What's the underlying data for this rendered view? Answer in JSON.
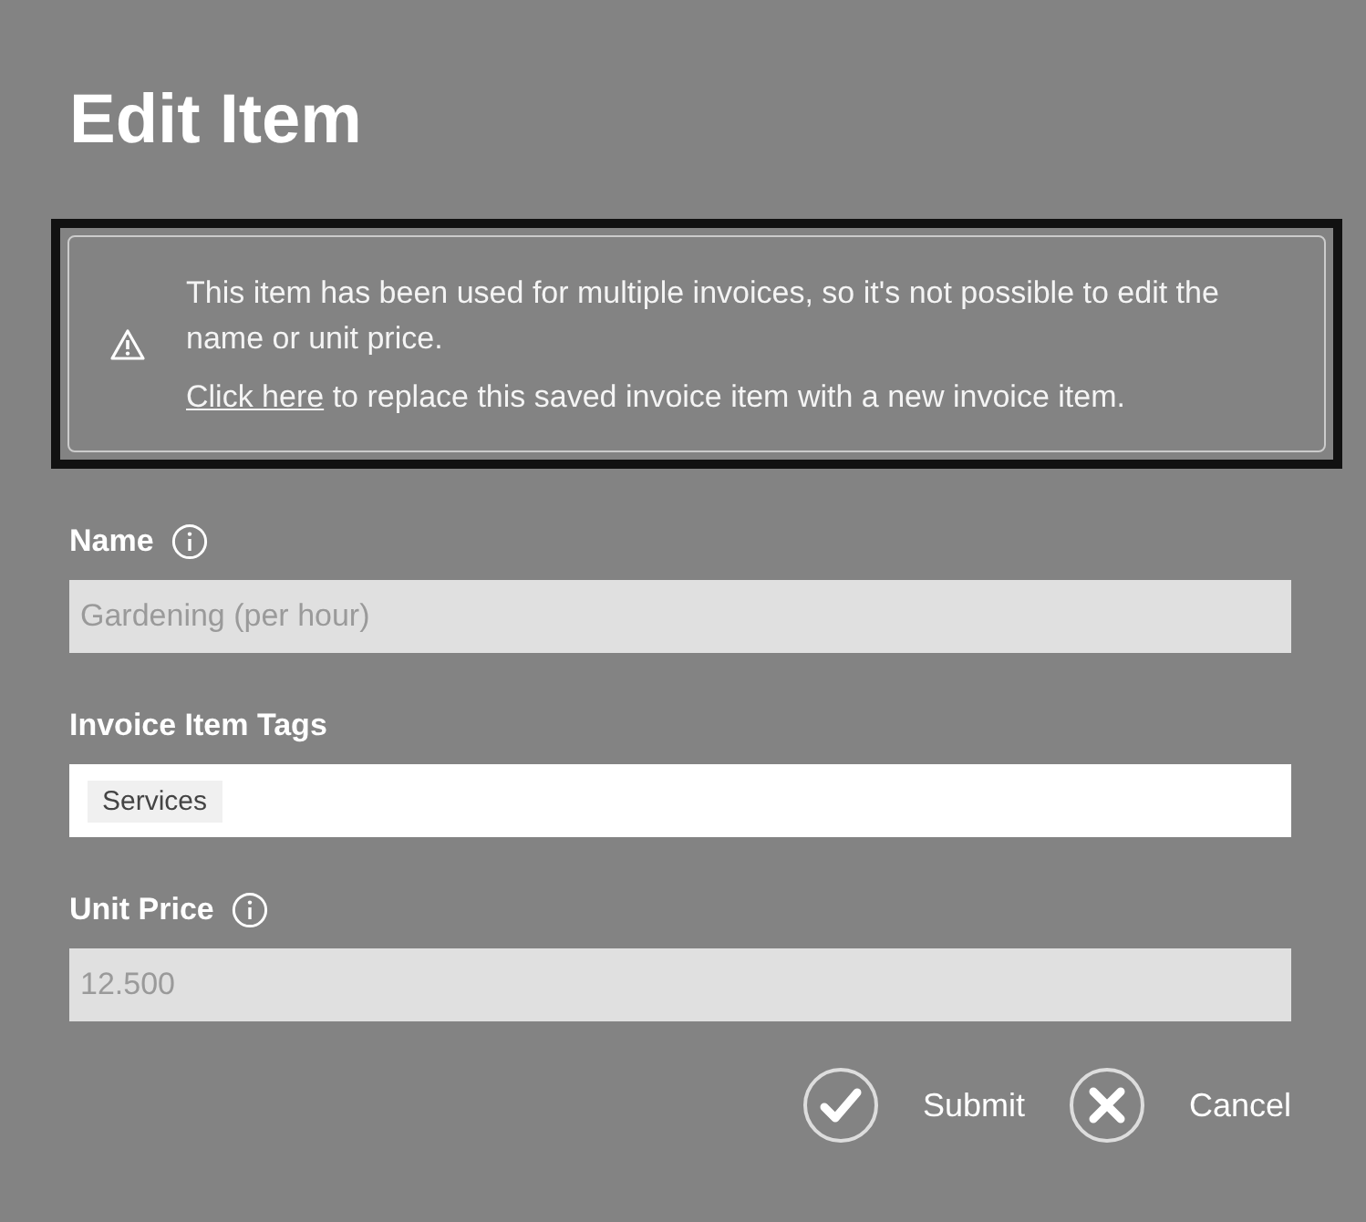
{
  "title": "Edit Item",
  "notice": {
    "message": "This item has been used for multiple invoices, so it's not possible to edit the name or unit price.",
    "link": "Click here",
    "link_rest": " to replace this saved invoice item with a new invoice item."
  },
  "fields": [
    {
      "kind": "text",
      "label": "Name",
      "info": true,
      "value": "Gardening (per hour)",
      "disabled": true
    },
    {
      "kind": "tags",
      "label": "Invoice Item Tags",
      "info": false,
      "tags": [
        "Services"
      ],
      "disabled": false
    },
    {
      "kind": "text",
      "label": "Unit Price",
      "info": true,
      "value": "12.500",
      "disabled": true
    }
  ],
  "buttons": [
    {
      "kind": "submit",
      "label": "Submit"
    },
    {
      "kind": "cancel",
      "label": "Cancel"
    }
  ]
}
